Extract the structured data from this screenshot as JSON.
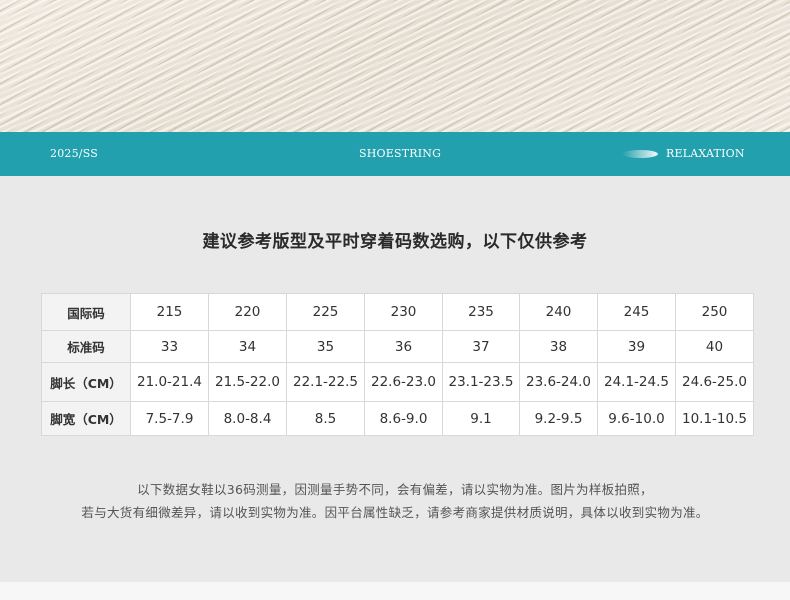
{
  "header": {
    "season": "2025/SS",
    "brand": "SHOESTRING",
    "tagline": "RELAXATION"
  },
  "title": "建议参考版型及平时穿着码数选购，以下仅供参考",
  "size_table": {
    "rows": [
      {
        "label": "国际码",
        "values": [
          "215",
          "220",
          "225",
          "230",
          "235",
          "240",
          "245",
          "250"
        ]
      },
      {
        "label": "标准码",
        "values": [
          "33",
          "34",
          "35",
          "36",
          "37",
          "38",
          "39",
          "40"
        ]
      },
      {
        "label": "脚长（CM）",
        "values": [
          "21.0-21.4",
          "21.5-22.0",
          "22.1-22.5",
          "22.6-23.0",
          "23.1-23.5",
          "23.6-24.0",
          "24.1-24.5",
          "24.6-25.0"
        ]
      },
      {
        "label": "脚宽（CM）",
        "values": [
          "7.5-7.9",
          "8.0-8.4",
          "8.5",
          "8.6-9.0",
          "9.1",
          "9.2-9.5",
          "9.6-10.0",
          "10.1-10.5"
        ]
      }
    ]
  },
  "notes": {
    "line1": "以下数据女鞋以36码测量，因测量手势不同，会有偏差，请以实物为准。图片为样板拍照，",
    "line2": "若与大货有细微差异，请以收到实物为准。因平台属性缺乏，请参考商家提供材质说明，具体以收到实物为准。"
  },
  "colors": {
    "band": "#22a0ae",
    "background": "#e9e9e9"
  }
}
